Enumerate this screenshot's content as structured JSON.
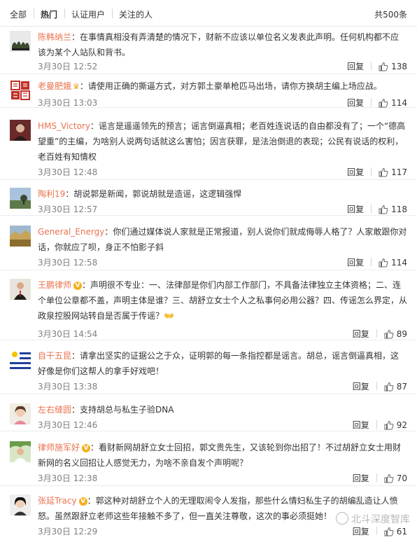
{
  "tabs": {
    "all": "全部",
    "hot": "热门",
    "verified": "认证用户",
    "following": "关注的人",
    "total": "共500条"
  },
  "labels": {
    "reply": "回复"
  },
  "colors": {
    "username": "#eb7350",
    "date": "#808080",
    "badge": "#f6b01d"
  },
  "comments": [
    {
      "user": "陈韩纳兰",
      "text": "：在事情真相没有弄清楚的情况下，财新不应该以单位名义发表此声明。任何机构都不应该为某个人站队和背书。",
      "date": "3月30日 12:52",
      "likes": "138",
      "avatar_icon": "shrubs-avatar"
    },
    {
      "user": "老曼肥娥",
      "text": "：请使用正确的撕逼方式，对方郭土豪单枪匹马出场，请你方换胡主编上场应战。",
      "date": "3月30日 13:03",
      "likes": "114",
      "avatar_icon": "red-seal-avatar"
    },
    {
      "user": "HMS_Victory",
      "text": "：谣言是遥遥领先的预言；谣言倒逼真相；老百姓连说话的自由都没有了；一个“德高望重”的主编，为啥别人说两句话就这么害怕；因言获罪，是法治倒退的表现；公民有说话的权利，老百姓有知情权",
      "date": "3月30日 12:48",
      "likes": "117",
      "avatar_icon": "portrait-avatar"
    },
    {
      "user": "陶利19",
      "text": "：胡说郭是新闻，郭说胡就是造谣，这逻辑强悍",
      "date": "3月30日 12:57",
      "likes": "118",
      "avatar_icon": "landscape-avatar"
    },
    {
      "user": "General_Energy",
      "text": "：你们通过媒体说人家就是正常报道，别人说你们就成侮辱人格了？人家敢跟你对话，你就应了呗，身正不怕影子斜",
      "date": "3月30日 12:58",
      "likes": "114",
      "avatar_icon": "field-avatar"
    },
    {
      "user": "王鹏律师",
      "text": "：声明很不专业：一、法律部是你们内部工作部门，不具备法律独立主体资格；二、连个单位公章都不盖，声明主体是谁？三、胡舒立女士个人之私事何必用公器？四、传谣怎么界定，从政泉控股网站转自是否属于传谣？",
      "date": "3月30日 14:54",
      "likes": "89",
      "avatar_icon": "suit-avatar",
      "emoji": "👐"
    },
    {
      "user": "自干五昆",
      "text": "：请拿出坚实的证据公之于众，证明郭的每一条指控都是谣言。胡总，谣言倒逼真相，这好像是你们这帮人的拿手好戏吧！",
      "date": "3月30日 13:38",
      "likes": "87",
      "avatar_icon": "flag-avatar"
    },
    {
      "user": "左右缝圆",
      "text": "：支持胡总与私生子验DNA",
      "date": "3月30日 12:46",
      "likes": "92",
      "avatar_icon": "girl-avatar"
    },
    {
      "user": "律师施军好",
      "text": "：看财新网胡舒立女士回招，郭文贵先生，又该轮到你出招了！不过胡舒立女士用财新网的名义回招让人感觉无力，为啥不亲自发个声明呢？",
      "date": "3月30日 12:38",
      "likes": "70",
      "avatar_icon": "outdoor-avatar"
    },
    {
      "user": "张延Tracy",
      "text": "：郭这种对胡舒立个人的无理取闹令人发指，那些什么情妇私生子的胡编乱造让人愤怒。虽然跟舒立老师这些年接触不多了，但一直关注尊敬，这次的事必须挺她！",
      "date": "3月30日 12:29",
      "likes": "61",
      "avatar_icon": "woman-avatar"
    }
  ],
  "watermark": "北斗深度智库"
}
